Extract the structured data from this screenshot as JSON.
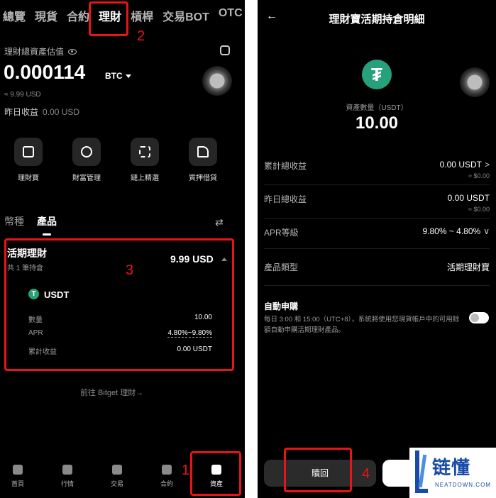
{
  "left": {
    "top_tabs": [
      "總覽",
      "現貨",
      "合約",
      "理財",
      "槓桿",
      "交易BOT",
      "OTC"
    ],
    "active_tab": "理財",
    "asset": {
      "label": "理財總資產估值",
      "value": "0.000114",
      "unit": "BTC",
      "approx": "≈ 9.99 USD",
      "yesterday_label": "昨日收益",
      "yesterday_value": "0.00 USD"
    },
    "quick_links": [
      "理財寶",
      "財富管理",
      "鏈上精選",
      "質押借貸"
    ],
    "sub_tabs": [
      "幣種",
      "產品"
    ],
    "active_sub_tab": "產品",
    "product_card": {
      "title": "活期理財",
      "subtitle": "共 1 筆持倉",
      "amount": "9.99 USD",
      "coin": "USDT",
      "rows": [
        {
          "key": "數量",
          "value": "10.00"
        },
        {
          "key": "APR",
          "value": "4.80%~9.80%"
        },
        {
          "key": "累計收益",
          "value": "0.00 USDT"
        }
      ]
    },
    "goto_link": "前往 Bitget 理財→",
    "bottom_nav": [
      "首頁",
      "行情",
      "交易",
      "合約",
      "資產"
    ],
    "active_nav": "資產"
  },
  "right": {
    "title": "理財寶活期持倉明細",
    "qty_label": "資產數量（USDT）",
    "qty_value": "10.00",
    "rows": [
      {
        "key": "累計總收益",
        "value": "0.00 USDT",
        "sub": "≈ $0.00",
        "chevron": ">"
      },
      {
        "key": "昨日總收益",
        "value": "0.00 USDT",
        "sub": "≈ $0.00"
      },
      {
        "key": "APR等級",
        "value": "9.80% ~ 4.80%",
        "chevron": "∨"
      },
      {
        "key": "產品類型",
        "value": "活期理財寶"
      }
    ],
    "auto": {
      "title": "自動申購",
      "desc": "每日 3:00 和 15:00（UTC+8），系統將使用您現貨帳戶中的可用餘額自動申購活期理財產品。"
    },
    "redeem_label": "贖回"
  },
  "annotations": [
    "2",
    "3",
    "1",
    "4"
  ],
  "watermark": {
    "text": "链懂",
    "sub": "NEATDOWN.COM"
  },
  "colors": {
    "highlight": "#e8141b",
    "usdt": "#26a17b",
    "background": "#000000"
  }
}
